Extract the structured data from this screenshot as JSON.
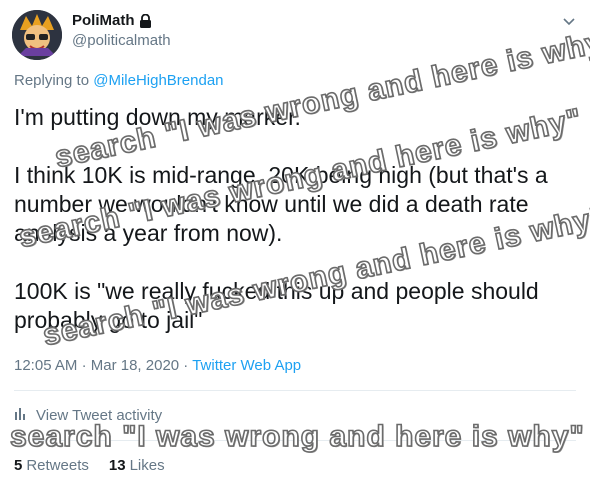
{
  "author": {
    "display_name": "PoliMath",
    "handle": "@politicalmath",
    "protected_icon": "lock-icon"
  },
  "reply": {
    "prefix": "Replying to",
    "mention": "@MileHighBrendan"
  },
  "tweet": {
    "paragraphs": [
      "I'm putting down my marker.",
      "I think 10K is mid-range, 20K being high (but that's a number we wouldn't know until we did a death rate analysis a year from now).",
      "100K is \"we really fucked this up and people should probably go to jail\""
    ]
  },
  "meta": {
    "time": "12:05 AM",
    "date": "Mar 18, 2020",
    "separator": "·",
    "source": "Twitter Web App"
  },
  "activity": {
    "label": "View Tweet activity",
    "icon": "bar-chart-icon"
  },
  "stats": {
    "retweets_count": "5",
    "retweets_label": "Retweets",
    "likes_count": "13",
    "likes_label": "Likes"
  },
  "watermark": {
    "text": "search \"I was wrong and here is why\""
  },
  "colors": {
    "link": "#1da1f2",
    "secondary": "#657786",
    "text": "#14171a",
    "divider": "#e6ecf0"
  }
}
